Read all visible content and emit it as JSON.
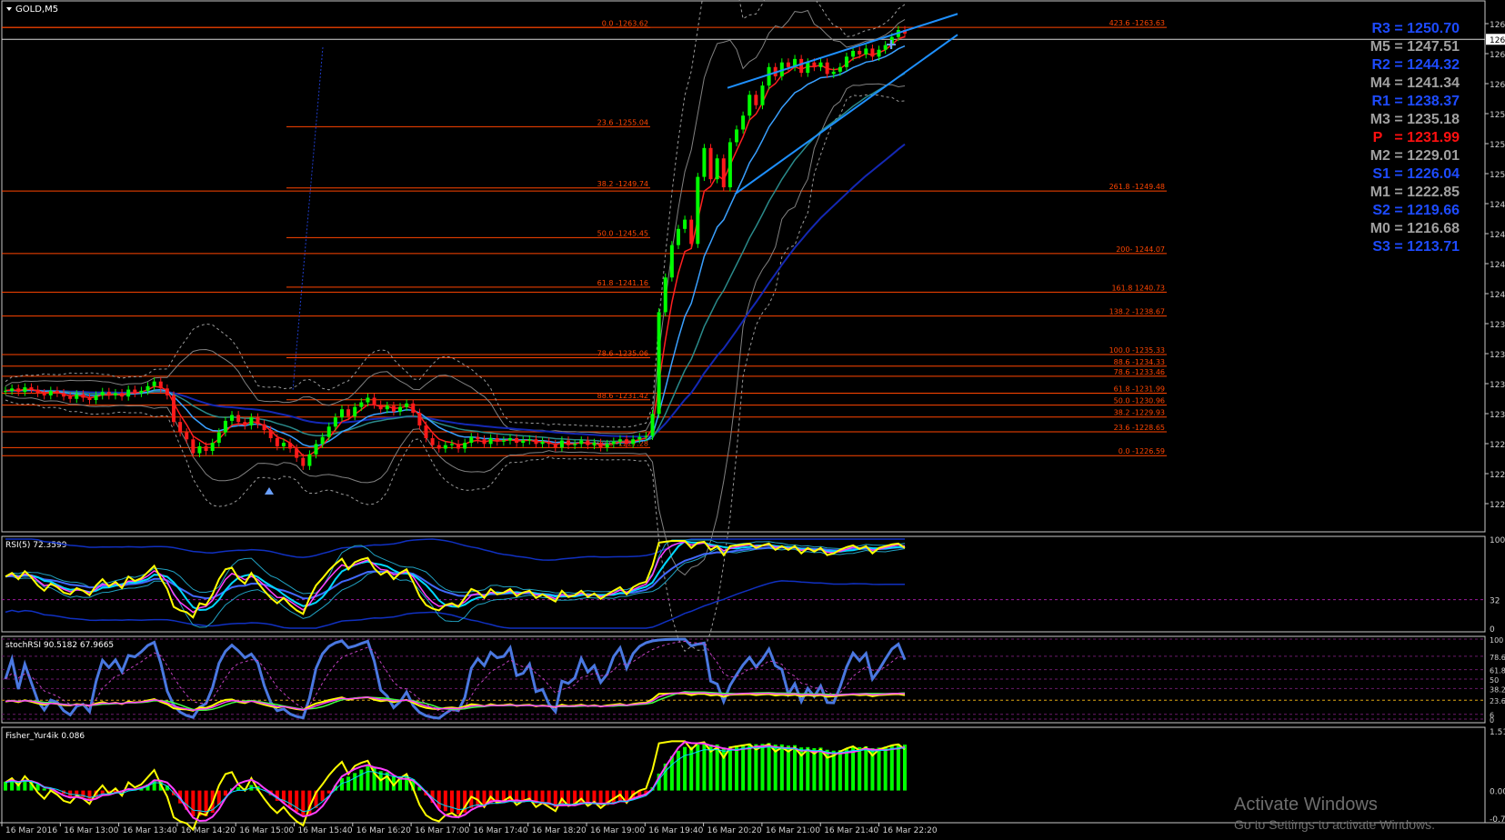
{
  "window": {
    "symbol": "GOLD,M5",
    "menu_icon": "triangle-down-icon"
  },
  "colors": {
    "bull": "#00ff00",
    "bear": "#ff1a1a",
    "fib": "#ff4500",
    "trend": "#1e90ff",
    "rsi_yellow": "#ffff00",
    "aqua": "#00e5ff",
    "magenta": "#ff00ff",
    "blue": "#4169e1",
    "fisher_pos": "#00ff00",
    "fisher_neg": "#ff0000"
  },
  "price_axis": {
    "labels": [
      "126",
      "126",
      "126",
      "125",
      "125",
      "125",
      "124",
      "124",
      "124",
      "124",
      "123",
      "123",
      "123",
      "123",
      "122",
      "122",
      "122"
    ],
    "current": "126"
  },
  "pivots": [
    {
      "label": "R3 = 1250.70",
      "color": "#1e4bff"
    },
    {
      "label": "M5 = 1247.51",
      "color": "#a0a0a0"
    },
    {
      "label": "R2 = 1244.32",
      "color": "#1e4bff"
    },
    {
      "label": "M4 = 1241.34",
      "color": "#a0a0a0"
    },
    {
      "label": "R1 = 1238.37",
      "color": "#1e4bff"
    },
    {
      "label": "M3 = 1235.18",
      "color": "#a0a0a0"
    },
    {
      "label": "P   = 1231.99",
      "color": "#ff1010"
    },
    {
      "label": "M2 = 1229.01",
      "color": "#a0a0a0"
    },
    {
      "label": "S1 = 1226.04",
      "color": "#1e4bff"
    },
    {
      "label": "M1 = 1222.85",
      "color": "#a0a0a0"
    },
    {
      "label": "S2 = 1219.66",
      "color": "#1e4bff"
    },
    {
      "label": "M0 = 1216.68",
      "color": "#a0a0a0"
    },
    {
      "label": "S3 = 1213.71",
      "color": "#1e4bff"
    }
  ],
  "fib_left": [
    "0.0 -1263.62",
    "23.6 -1255.04",
    "38.2 -1249.74",
    "50.0 -1245.45",
    "61.8 -1241.16",
    "78.6 -1235.06",
    "88.6 -1231.42",
    "100.0 -1227.28"
  ],
  "fib_right": [
    "423.6 -1263.63",
    "261.8 -1249.48",
    "200- 1244.07",
    "161.8 1240.73",
    "138.2 -1238.67",
    "100.0 -1235.33",
    "88.6 -1234.33",
    "78.6 -1233.46",
    "61.8 -1231.99",
    "50.0 -1230.96",
    "38.2 -1229.93",
    "23.6 -1228.65",
    "0.0 -1226.59"
  ],
  "panels": {
    "rsi": {
      "label": "RSI(5) 72.3599",
      "ticks": [
        "100",
        "32",
        "0"
      ]
    },
    "stoch": {
      "label": "stochRSI 90.5182 67.9665",
      "ticks": [
        "100",
        "78.6",
        "61.8",
        "50",
        "38.2",
        "23.6",
        "6",
        "0"
      ]
    },
    "fisher": {
      "label": "Fisher_Yur4ik 0.086",
      "ticks": [
        "1.51",
        "0.00",
        "-0.7"
      ]
    }
  },
  "time_axis": [
    "16 Mar 2016",
    "16 Mar 13:00",
    "16 Mar 13:40",
    "16 Mar 14:20",
    "16 Mar 15:00",
    "16 Mar 15:40",
    "16 Mar 16:20",
    "16 Mar 17:00",
    "16 Mar 17:40",
    "16 Mar 18:20",
    "16 Mar 19:00",
    "16 Mar 19:40",
    "16 Mar 20:20",
    "16 Mar 21:00",
    "16 Mar 21:40",
    "16 Mar 22:20"
  ],
  "watermark": {
    "title": "Activate Windows",
    "subtitle": "Go to Settings to activate Windows."
  },
  "chart_data": [
    {
      "type": "candlestick",
      "title": "GOLD,M5",
      "ylim": [
        1220,
        1266
      ],
      "fib_levels": [
        1263.62,
        1255.04,
        1249.74,
        1245.45,
        1241.16,
        1235.06,
        1231.42,
        1227.28
      ],
      "fib_ext_levels": [
        1263.63,
        1249.48,
        1244.07,
        1240.73,
        1238.67,
        1235.33,
        1234.33,
        1233.46,
        1231.99,
        1230.96,
        1229.93,
        1228.65,
        1226.59
      ],
      "close": [
        1232.2,
        1232.4,
        1232.1,
        1232.5,
        1232.3,
        1232.0,
        1231.8,
        1232.2,
        1232.0,
        1231.7,
        1231.5,
        1231.9,
        1231.6,
        1231.4,
        1231.8,
        1232.1,
        1231.8,
        1232.0,
        1231.7,
        1232.3,
        1232.0,
        1232.2,
        1232.6,
        1233.0,
        1232.4,
        1231.8,
        1229.5,
        1228.6,
        1228.0,
        1226.8,
        1227.4,
        1227.0,
        1227.7,
        1228.6,
        1229.6,
        1230.1,
        1229.5,
        1229.2,
        1229.9,
        1229.3,
        1228.8,
        1228.1,
        1227.4,
        1227.7,
        1227.2,
        1226.4,
        1225.7,
        1226.7,
        1227.6,
        1228.2,
        1229.1,
        1229.9,
        1230.6,
        1230.0,
        1230.8,
        1231.2,
        1231.6,
        1231.0,
        1230.6,
        1230.9,
        1230.4,
        1230.8,
        1231.1,
        1230.3,
        1229.2,
        1228.1,
        1227.5,
        1227.2,
        1227.5,
        1227.6,
        1227.2,
        1227.7,
        1228.2,
        1228.0,
        1227.6,
        1228.1,
        1227.8,
        1227.9,
        1228.1,
        1227.7,
        1227.9,
        1228.0,
        1227.6,
        1227.8,
        1227.6,
        1227.3,
        1227.9,
        1227.5,
        1227.6,
        1227.9,
        1227.5,
        1227.7,
        1227.3,
        1227.6,
        1227.8,
        1228.0,
        1227.6,
        1228.0,
        1228.2,
        1228.3,
        1230.2,
        1239.0,
        1242.0,
        1244.8,
        1246.2,
        1247.0,
        1244.9,
        1250.7,
        1253.2,
        1250.5,
        1252.3,
        1249.8,
        1253.7,
        1254.8,
        1256.0,
        1257.8,
        1256.9,
        1258.6,
        1260.2,
        1259.4,
        1260.6,
        1260.2,
        1260.9,
        1259.7,
        1260.6,
        1260.2,
        1260.6,
        1259.6,
        1259.8,
        1260.2,
        1261.1,
        1261.6,
        1261.3,
        1261.8,
        1261.1,
        1261.7,
        1262.1,
        1262.8,
        1263.4,
        1263.1
      ]
    },
    {
      "type": "line",
      "title": "RSI(5) 72.3599",
      "ylim": [
        0,
        100
      ],
      "series": [
        {
          "name": "RSI(5)",
          "values": [
            58,
            62,
            55,
            64,
            57,
            48,
            42,
            50,
            46,
            40,
            38,
            45,
            42,
            37,
            48,
            55,
            47,
            52,
            45,
            58,
            53,
            56,
            63,
            70,
            56,
            44,
            24,
            20,
            18,
            12,
            28,
            26,
            38,
            55,
            66,
            68,
            56,
            50,
            62,
            51,
            42,
            34,
            28,
            34,
            26,
            20,
            16,
            34,
            48,
            56,
            65,
            72,
            78,
            66,
            74,
            77,
            79,
            67,
            60,
            64,
            55,
            62,
            66,
            52,
            36,
            26,
            22,
            20,
            26,
            28,
            24,
            34,
            44,
            41,
            34,
            44,
            38,
            40,
            44,
            36,
            40,
            42,
            34,
            38,
            34,
            30,
            42,
            35,
            37,
            42,
            35,
            39,
            33,
            38,
            42,
            46,
            38,
            46,
            50,
            52,
            70,
            96,
            97,
            98,
            98,
            98,
            90,
            96,
            97,
            88,
            92,
            82,
            92,
            93,
            94,
            95,
            90,
            93,
            95,
            88,
            92,
            88,
            92,
            84,
            90,
            86,
            90,
            82,
            84,
            88,
            91,
            93,
            89,
            92,
            84,
            90,
            92,
            94,
            95,
            90
          ]
        }
      ]
    },
    {
      "type": "bar",
      "title": "Fisher_Yur4ik 0.086",
      "ylim": [
        -0.7,
        1.51
      ]
    }
  ]
}
